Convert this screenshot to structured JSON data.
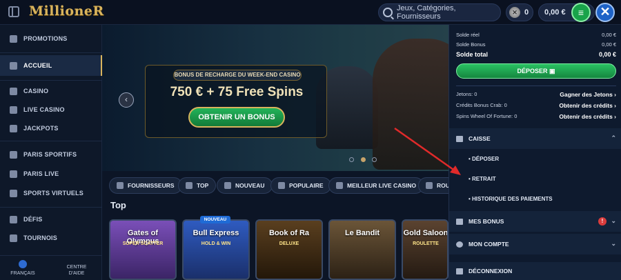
{
  "header": {
    "logo": "MillioneR",
    "search_placeholder": "Jeux, Catégories, Fournisseurs",
    "tokens": "0",
    "balance": "0,00 €"
  },
  "sidebar": {
    "items": [
      {
        "label": "PROMOTIONS"
      },
      {
        "label": "ACCUEIL"
      },
      {
        "label": "CASINO"
      },
      {
        "label": "LIVE CASINO"
      },
      {
        "label": "JACKPOTS"
      },
      {
        "label": "PARIS SPORTIFS"
      },
      {
        "label": "PARIS LIVE"
      },
      {
        "label": "SPORTS VIRTUELS"
      },
      {
        "label": "DÉFIS"
      },
      {
        "label": "TOURNOIS"
      }
    ],
    "footer": {
      "language": "FRANÇAIS",
      "help": "CENTRE D'AIDE"
    }
  },
  "banner": {
    "tag": "BONUS DE RECHARGE DU WEEK-END CASINO",
    "title": "750 € + 75 Free Spins",
    "button": "OBTENIR UN BONUS"
  },
  "filters": [
    "FOURNISSEURS",
    "TOP",
    "NOUVEAU",
    "POPULAIRE",
    "MEILLEUR LIVE CASINO",
    "ROU"
  ],
  "section": {
    "title": "Top"
  },
  "games": [
    {
      "title": "Gates of Olympus",
      "sub": "SUPER SCATTER",
      "color": "#6a3fa0"
    },
    {
      "title": "Bull Express",
      "sub": "HOLD & WIN",
      "color": "#2d4fa8"
    },
    {
      "title": "Book of Ra",
      "sub": "DELUXE",
      "color": "#3b2c1a"
    },
    {
      "title": "Le Bandit",
      "sub": "",
      "color": "#4a3a26"
    },
    {
      "title": "Gold Saloon",
      "sub": "ROULETTE",
      "color": "#3b2a1e"
    }
  ],
  "new_badge": "NOUVEAU",
  "panel": {
    "balances": [
      {
        "label": "Solde réel",
        "value": "0,00 €"
      },
      {
        "label": "Solde Bonus",
        "value": "0,00 €"
      },
      {
        "label": "Solde total",
        "value": "0,00 €"
      }
    ],
    "deposit_button": "DÉPOSER",
    "infos": [
      {
        "label": "Jetons: 0",
        "link": "Gagner des Jetons"
      },
      {
        "label": "Crédits Bonus Crab: 0",
        "link": "Obtenir des crédits"
      },
      {
        "label": "Spins Wheel Of Fortune: 0",
        "link": "Obtenir des crédits"
      }
    ],
    "caisse": {
      "title": "CAISSE",
      "items": [
        "DÉPOSER",
        "RETRAIT",
        "HISTORIQUE DES PAIEMENTS"
      ]
    },
    "mes_bonus": "MES BONUS",
    "alert": "!",
    "mon_compte": "MON COMPTE",
    "logout": "DÉCONNEXION"
  }
}
